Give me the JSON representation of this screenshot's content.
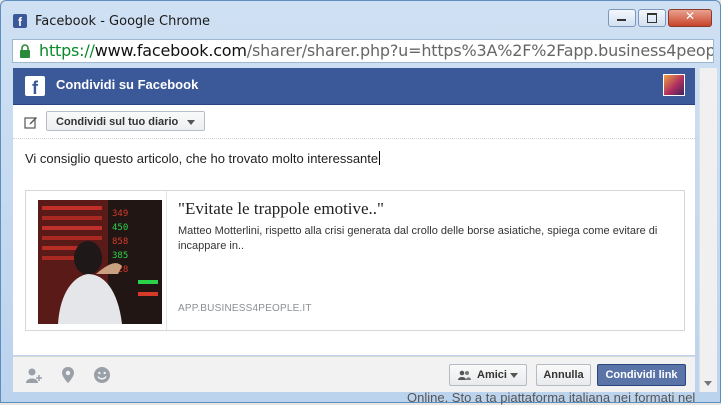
{
  "window": {
    "title": "Facebook - Google Chrome",
    "url_scheme": "https://",
    "url_host": "www.facebook.com",
    "url_path": "/sharer/sharer.php?u=https%3A%2F%2Fapp.business4people.it%"
  },
  "fb_header": {
    "title": "Condividi su Facebook"
  },
  "toolbar": {
    "share_target_label": "Condividi sul tuo diario"
  },
  "composer": {
    "message": "Vi consiglio questo articolo, che ho trovato molto interessante"
  },
  "link_preview": {
    "title": "\"Evitate le trappole emotive..\"",
    "description": "Matteo Motterlini, rispetto alla crisi generata dal crollo delle borse asiatiche, spiega come evitare di incappare in..",
    "domain": "APP.BUSINESS4PEOPLE.IT",
    "thumb_numbers": [
      "349",
      "450",
      "858",
      "385",
      "328"
    ]
  },
  "footer": {
    "audience_label": "Amici",
    "cancel_label": "Annulla",
    "share_label": "Condividi link"
  },
  "background": {
    "text": "Online. Sto a ta piattaforma italiana nei formati nel"
  },
  "colors": {
    "facebook_blue": "#3b5998",
    "primary_button": "#5b74a8",
    "url_scheme_green": "#0a8a2a"
  },
  "icons": [
    "facebook-icon",
    "lock-icon",
    "pencil-icon",
    "caret-down-icon",
    "add-person-icon",
    "location-pin-icon",
    "smiley-icon",
    "friends-icon"
  ]
}
